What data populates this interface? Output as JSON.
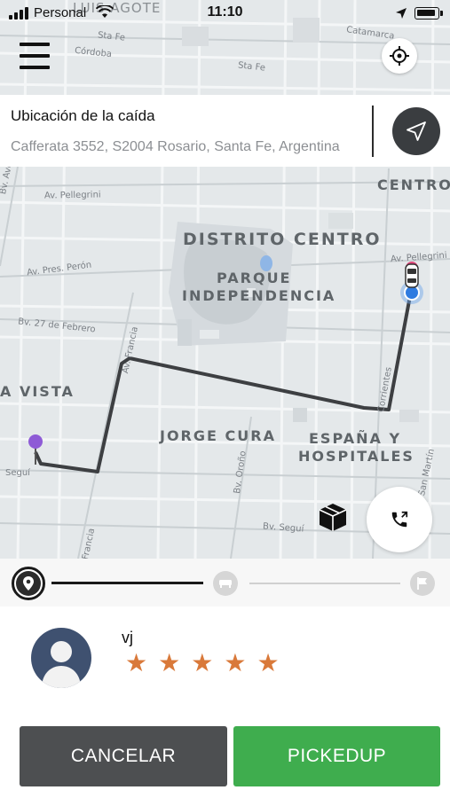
{
  "status_bar": {
    "carrier": "Personal",
    "time": "11:10"
  },
  "map": {
    "street_labels": {
      "sta_fe_1": "Sta Fe",
      "cordoba": "Córdoba",
      "sta_fe_2": "Sta Fe",
      "catamarca": "Catamarca",
      "lui_agote": "LUIS AGOTE",
      "pellegrini_1": "Av. Pellegrini",
      "pellegrini_2": "Av. Pellegrini",
      "avellaneda": "Bv. Avellaneda",
      "pres_peron": "Av. Pres. Perón",
      "febrero": "Bv. 27 de Febrero",
      "francia_1": "Av. Francia",
      "francia_2": "Francia",
      "corrientes": "Corrientes",
      "orono": "Bv. Oroño",
      "segui_1": "Seguí",
      "segui_2": "Bv. Seguí",
      "san_martin": "San Martín"
    },
    "districts": {
      "centro": "CENTRO",
      "distrito_centro": "DISTRITO CENTRO",
      "parque_1": "PARQUE",
      "parque_2": "INDEPENDENCIA",
      "vista": "A VISTA",
      "jorge_cura": "JORGE CURA",
      "espana_1": "ESPAÑA Y",
      "espana_2": "HOSPITALES"
    }
  },
  "address": {
    "title": "Ubicación de la caída",
    "value": "Cafferata 3552, S2004 Rosario, Santa Fe, Argentina"
  },
  "progress": {
    "current_step": 1,
    "total_steps": 3,
    "fraction": 0.5
  },
  "passenger": {
    "name": "vj",
    "rating": 5,
    "stars": [
      "★",
      "★",
      "★",
      "★",
      "★"
    ]
  },
  "actions": {
    "cancel_label": "CANCELAR",
    "pickup_label": "PICKEDUP"
  },
  "colors": {
    "pickup_green": "#3fad4e",
    "cancel_gray": "#4d4f51",
    "star_orange": "#d9793a",
    "route": "#3d3f42",
    "origin_pin": "#8e5bd6",
    "driver": "#2f7be0"
  }
}
